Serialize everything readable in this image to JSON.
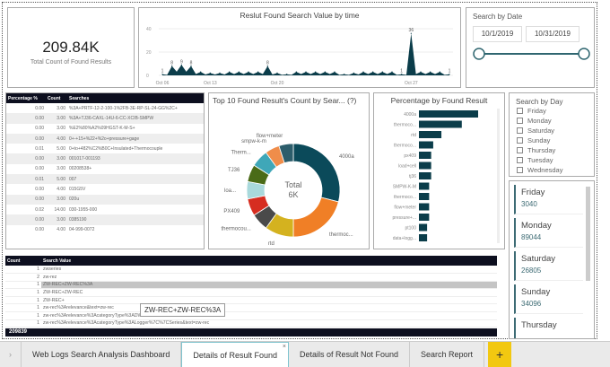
{
  "kpi": {
    "value": "209.84K",
    "label": "Total Count of Found Results"
  },
  "line_chart": {
    "title": "Reslut Found Search Value by time",
    "y_ticks": [
      "0",
      "20",
      "40"
    ],
    "x_ticks": [
      "Oct 06",
      "Oct 13",
      "Oct 20",
      "Oct 27"
    ]
  },
  "date_slicer": {
    "label": "Search by Date",
    "start": "10/1/2019",
    "end": "10/31/2019"
  },
  "search_table": {
    "headers": [
      "Percentage %",
      "Count",
      "Searches"
    ],
    "rows": [
      [
        "0.00",
        "3.00",
        "%3A+PRTF-12-2-100-1%2FB-3E-RP-SL-24-GG%2C+"
      ],
      [
        "0.00",
        "3.00",
        "%3A+TJ36-CAXL-14U-6-CC-XCIB-SMPW"
      ],
      [
        "0.00",
        "3.00",
        "%E2%80%A2%09HGST-K-M-S+"
      ],
      [
        "0.00",
        "4.00",
        "0+-+15+%22+%2o+pressure+gage"
      ],
      [
        "0.01",
        "5.00",
        "0+to+482%C2%B0C+Insulated+Thermocouple"
      ],
      [
        "0.00",
        "3.00",
        "001017-001193"
      ],
      [
        "0.00",
        "3.00",
        "00208538+"
      ],
      [
        "0.01",
        "5.00",
        "007"
      ],
      [
        "0.00",
        "4.00",
        "015G5V"
      ],
      [
        "0.00",
        "3.00",
        "020u"
      ],
      [
        "0.02",
        "14.00",
        "030-1955-000"
      ],
      [
        "0.00",
        "3.00",
        "0385190"
      ],
      [
        "0.00",
        "4.00",
        "04-999-0072"
      ]
    ]
  },
  "donut": {
    "title": "Top 10 Found Result's Count by Sear... (?)",
    "center_label": "Total",
    "center_value": "6K"
  },
  "bar": {
    "title": "Percentage by Found Result",
    "x_tick": "0"
  },
  "day_slicer": {
    "label": "Search by Day",
    "options": [
      "Friday",
      "Monday",
      "Saturday",
      "Sunday",
      "Thursday",
      "Tuesday",
      "Wednesday"
    ]
  },
  "day_cards": [
    {
      "day": "Friday",
      "value": "3040"
    },
    {
      "day": "Monday",
      "value": "89044"
    },
    {
      "day": "Saturday",
      "value": "26805"
    },
    {
      "day": "Sunday",
      "value": "34096"
    },
    {
      "day": "Thursday",
      "value": ""
    }
  ],
  "value_table": {
    "headers": [
      "Count",
      "Search Value"
    ],
    "rows": [
      [
        "1",
        "zwseries"
      ],
      [
        "2",
        "zw-rez"
      ],
      [
        "1",
        "ZW-REC+ZW-REC%3A"
      ],
      [
        "1",
        "ZW-REC+ZW-REC"
      ],
      [
        "1",
        "ZW-REC+"
      ],
      [
        "1",
        "zw-rec%3Arelevance&text=zw-rec"
      ],
      [
        "1",
        "zw-rec%3Arelevance%3AcategoryType%3ADWR%2BSeries&text=zw-rec&view="
      ],
      [
        "1",
        "zw-rec%3Arelevance%3AcategoryType%3ALogger%7C%7CSeries&text=zw-rec"
      ]
    ],
    "total": "209839",
    "tooltip": "ZW-REC+ZW-REC%3A",
    "selected_row": 2
  },
  "tabs": [
    {
      "label": "Web Logs Search Analysis Dashboard"
    },
    {
      "label": "Details of Result Found",
      "active": true
    },
    {
      "label": "Details of Result Not Found"
    },
    {
      "label": "Search Report"
    }
  ],
  "add_tab": "+",
  "chart_data": [
    {
      "type": "area",
      "title": "Reslut Found Search Value by time",
      "x": [
        "Oct 01",
        "Oct 02",
        "Oct 03",
        "Oct 04",
        "Oct 05",
        "Oct 06",
        "Oct 07",
        "Oct 08",
        "Oct 09",
        "Oct 10",
        "Oct 11",
        "Oct 12",
        "Oct 13",
        "Oct 14",
        "Oct 15",
        "Oct 16",
        "Oct 17",
        "Oct 18",
        "Oct 19",
        "Oct 20",
        "Oct 21",
        "Oct 22",
        "Oct 23",
        "Oct 24",
        "Oct 25",
        "Oct 26",
        "Oct 27",
        "Oct 28",
        "Oct 29",
        "Oct 30",
        "Oct 31"
      ],
      "values": [
        1,
        8,
        9,
        8,
        3,
        2,
        2,
        3,
        3,
        3,
        3,
        8,
        2,
        1,
        3,
        3,
        3,
        3,
        3,
        1,
        2,
        3,
        3,
        3,
        3,
        1,
        36,
        3,
        3,
        3,
        1
      ],
      "data_labels": [
        "1",
        "8",
        "9",
        "8",
        "8",
        "1",
        "36",
        "1"
      ],
      "ylim": [
        0,
        40
      ],
      "color": "#0b3d4a"
    },
    {
      "type": "pie",
      "title": "Top 10 Found Result's Count by Sear... (?)",
      "categories": [
        "4000a",
        "thermoc...",
        "rtd",
        "thermocou...",
        "PX409",
        "loa...",
        "TJ36",
        "Therm...",
        "smpw-k-m",
        "flow+meter"
      ],
      "values": [
        29,
        21,
        10,
        6,
        6,
        6,
        6,
        6,
        5,
        5
      ],
      "colors": [
        "#0b4a5a",
        "#f07f26",
        "#d4b21f",
        "#4a4a4a",
        "#d62d20",
        "#a9d9dc",
        "#4a6b17",
        "#3fa7b8",
        "#ef8d4a",
        "#2c5d6b"
      ],
      "total": "6K"
    },
    {
      "type": "bar",
      "orientation": "horizontal",
      "title": "Percentage by Found Result",
      "categories": [
        "4000a",
        "thermoco...",
        "rtd",
        "thermoco...",
        "px409",
        "load+cell",
        "tj36",
        "SMPW-K-M",
        "thermoco...",
        "flow+meter",
        "pressure+...",
        "pt100",
        "data+logg..."
      ],
      "values": [
        29,
        21,
        11,
        7,
        6,
        6,
        6,
        5,
        5,
        5,
        5,
        4,
        4
      ],
      "color": "#0b3d4a"
    }
  ]
}
